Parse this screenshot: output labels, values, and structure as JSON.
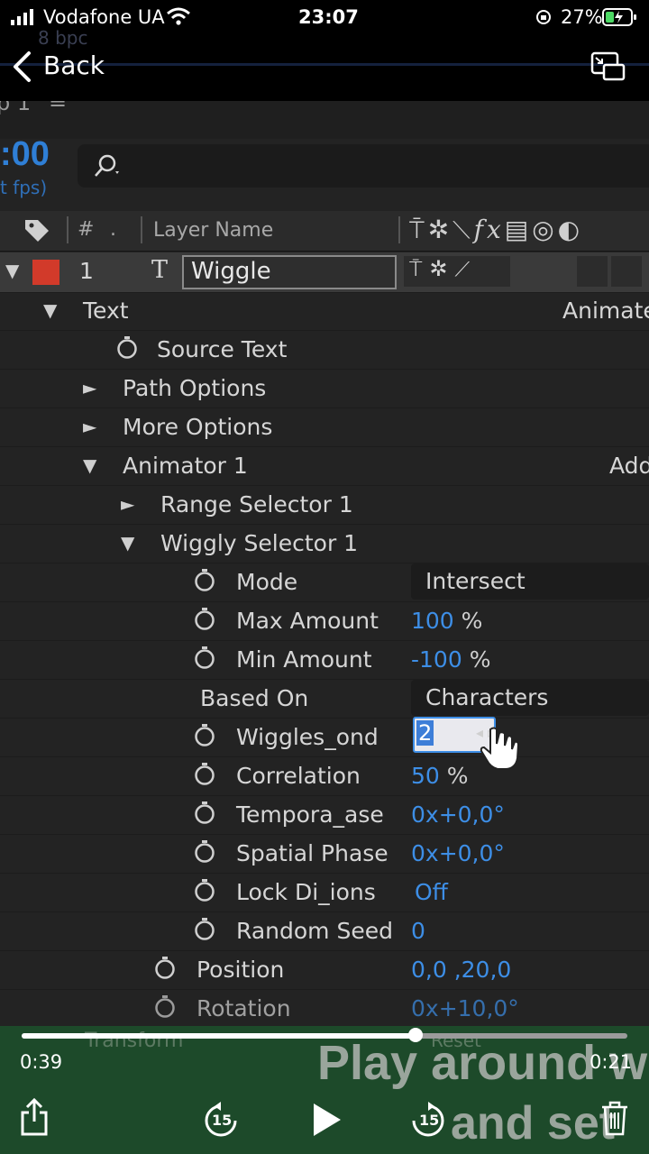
{
  "status_bar": {
    "carrier": "Vodafone UA",
    "time": "23:07",
    "battery_percent": "27%"
  },
  "nav": {
    "back_label": "Back"
  },
  "ae": {
    "bit_depth": "8 bpc",
    "comp_tab": "p 1",
    "timecode": ":00",
    "fps": "t fps)",
    "columns": {
      "number": "#",
      "layer_name": "Layer Name"
    },
    "layer": {
      "number": "1",
      "name": "Wiggle",
      "type_glyph": "T"
    },
    "rows": {
      "text": "Text",
      "text_right": "Animate",
      "source_text": "Source Text",
      "path_options": "Path Options",
      "more_options": "More Options",
      "animator": "Animator 1",
      "animator_right": "Add",
      "range_selector": "Range Selector 1",
      "wiggly_selector": "Wiggly Selector 1",
      "mode": "Mode",
      "mode_value": "Intersect",
      "max_amount": "Max Amount",
      "max_amount_value": "100",
      "min_amount": "Min Amount",
      "min_amount_value": "-100",
      "percent": "%",
      "based_on": "Based On",
      "based_on_value": "Characters",
      "wiggles": "Wiggles_ond",
      "wiggles_value": "2",
      "correlation": "Correlation",
      "correlation_value": "50",
      "temporal": "Tempora_ase",
      "temporal_value": "0x+0,0°",
      "spatial": "Spatial Phase",
      "spatial_value": "0x+0,0°",
      "lock": "Lock Di_ions",
      "lock_value": "Off",
      "seed": "Random Seed",
      "seed_value": "0",
      "position": "Position",
      "position_value": "0,0 ,20,0",
      "rotation": "Rotation",
      "rotation_value": "0x+10,0°"
    }
  },
  "video": {
    "elapsed": "0:39",
    "remaining": "0:21",
    "progress": 0.65,
    "caption_line1": "Play around w",
    "caption_line2": "and set h",
    "underlay_transform": "Transform",
    "underlay_reset": "Reset",
    "skip_seconds": "15"
  },
  "colors": {
    "accent_blue": "#3d8ee6",
    "label_red": "#d23a2a",
    "panel": "#232323"
  },
  "icons": [
    "signal-icon",
    "wifi-icon",
    "orientation-lock-icon",
    "battery-icon",
    "back-chevron-icon",
    "picture-in-picture-icon",
    "search-icon",
    "label-tag-icon",
    "stopwatch-icon",
    "text-tool-icon",
    "share-icon",
    "rewind-15-icon",
    "play-icon",
    "forward-15-icon",
    "trash-icon",
    "hand-cursor-icon"
  ]
}
